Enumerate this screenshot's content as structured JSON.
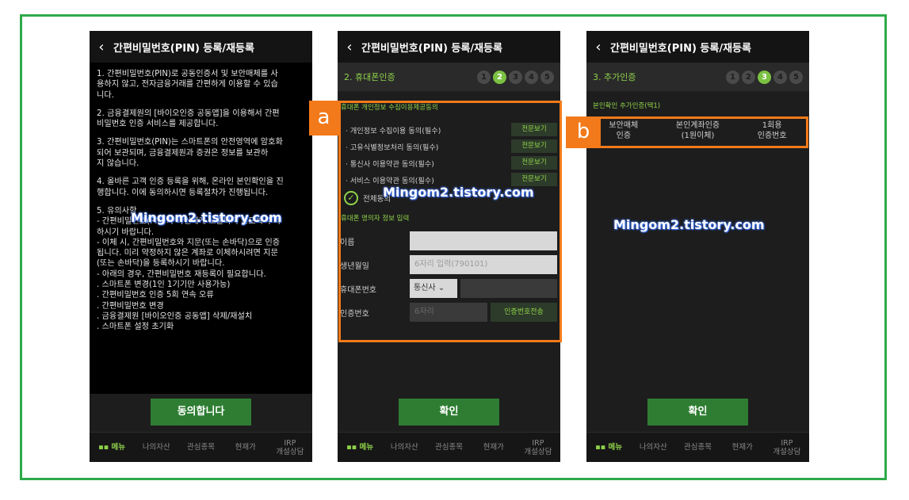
{
  "screen1": {
    "back_icon": "chevron-left-icon",
    "title": "간편비밀번호(PIN) 등록/재등록",
    "para1": [
      "1. 간편비밀번호(PIN)로 공동인증서 및 보안매체를 사",
      "용하지 않고, 전자금융거래를 간편하게 이용할 수 있습",
      "니다."
    ],
    "para2": [
      "2. 금융결제원의 [바이오인증 공동앱]을 이용해서 간편",
      "비밀번호 인증 서비스를 제공합니다."
    ],
    "para3": [
      "3. 간편비밀번호(PIN)는 스마트폰의 안전영역에 암호화",
      "되어 보관되며, 금융결제원과 증권은 정보를 보관하",
      "지 않습니다."
    ],
    "para4": [
      "4. 올바른 고객 인증 등록을 위해, 온라인 본인확인을 진",
      "행합니다. 이에 동의하시면 등록절차가 진행됩니다."
    ],
    "para5": [
      "5. 유의사항",
      "- 간편비밀번호(PIN)가 타인에게 노출되지 않도록 주의",
      "하시기 바랍니다.",
      "- 이체 시, 간편비밀번호와 지문(또는 손바닥)으로 인증",
      "됩니다. 미리 약정하지 않은 계좌로 이체하시려면 지문",
      "(또는 손바닥)을 등록하시기 바랍니다.",
      "- 아래의 경우, 간편비밀번호 재등록이 필요합니다.",
      ". 스마트폰 변경(1인 1기기만 사용가능)",
      ". 간편비밀번호 인증 5회 연속 오류",
      ". 간편비밀번호 변경",
      ". 금융결제원 [바이오인증 공동앱] 삭제/재설치",
      ". 스마트폰 설정 초기화"
    ],
    "agree_button": "동의합니다"
  },
  "screen2": {
    "title": "간편비밀번호(PIN) 등록/재등록",
    "step_title": "2. 휴대폰인증",
    "steps": [
      "1",
      "2",
      "3",
      "4",
      "5"
    ],
    "consent_title": "휴대폰 개인정보 수집이용제공동의",
    "consents": [
      "· 개인정보 수집이용 동의(필수)",
      "· 고유식별정보처리 동의(필수)",
      "· 통신사 이용약관 동의(필수)",
      "· 서비스 이용약관 동의(필수)"
    ],
    "view_label": "전문보기",
    "check_all": "전체동의",
    "info_title": "휴대폰 명의자 정보 입력",
    "name_label": "이름",
    "birth_label": "생년월일",
    "birth_placeholder": "6자리 입력(790101)",
    "phone_label": "휴대폰번호",
    "carrier": "통신사",
    "auth_label": "인증번호",
    "auth_placeholder": "6자리",
    "auth_send": "인증번호전송",
    "confirm": "확인"
  },
  "screen3": {
    "title": "간편비밀번호(PIN) 등록/재등록",
    "step_title": "3. 추가인증",
    "steps": [
      "1",
      "2",
      "3",
      "4",
      "5"
    ],
    "sub_title": "본인확인 추가인증(택1)",
    "options": [
      {
        "line1": "보안매체",
        "line2": "인증"
      },
      {
        "line1": "본인계좌인증",
        "line2": "(1원이체)"
      },
      {
        "line1": "1회용",
        "line2": "인증번호"
      }
    ],
    "confirm": "확인"
  },
  "tabbar": [
    "메뉴",
    "나의자산",
    "관심종목",
    "현재가",
    "IRP",
    "개설상담"
  ],
  "watermark": "Mingom2.tistory.com",
  "labels": {
    "a": "a",
    "b": "b"
  },
  "colors": {
    "frame": "#2eaa4a",
    "accent": "#8fd34a",
    "highlight": "#f27a1a",
    "button": "#2e7d32"
  }
}
